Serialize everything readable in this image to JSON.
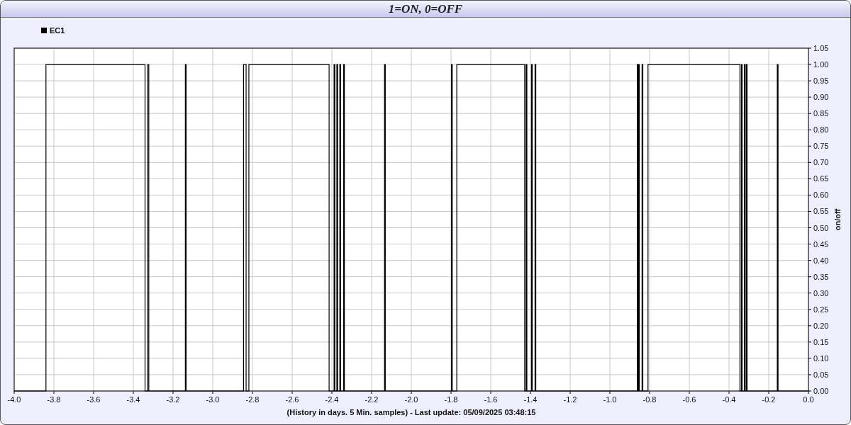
{
  "window": {
    "title": "1=ON, 0=OFF"
  },
  "chart": {
    "chart_data": {
      "type": "line",
      "grid": true,
      "xlabel": "(History in days. 5 Min. samples) - Last update: 05/09/2025 03:48:15",
      "ylabel": "on/off",
      "x": [
        -4,
        -3.84,
        -3.84,
        -3.341,
        -3.341,
        -3.327,
        -3.327,
        -3.322,
        -3.322,
        -3.138,
        -3.138,
        -3.134,
        -3.134,
        -2.845,
        -2.845,
        -2.832,
        -2.832,
        -2.818,
        -2.818,
        -2.414,
        -2.414,
        -2.389,
        -2.389,
        -2.385,
        -2.385,
        -2.375,
        -2.375,
        -2.371,
        -2.371,
        -2.36,
        -2.36,
        -2.356,
        -2.356,
        -2.341,
        -2.341,
        -2.337,
        -2.337,
        -2.135,
        -2.135,
        -2.131,
        -2.131,
        -1.798,
        -1.798,
        -1.794,
        -1.794,
        -1.771,
        -1.771,
        -1.429,
        -1.429,
        -1.422,
        -1.422,
        -1.418,
        -1.418,
        -1.395,
        -1.395,
        -1.391,
        -1.391,
        -1.377,
        -1.377,
        -1.373,
        -1.373,
        -0.862,
        -0.862,
        -0.858,
        -0.858,
        -0.856,
        -0.856,
        -0.852,
        -0.852,
        -0.838,
        -0.838,
        -0.834,
        -0.834,
        -0.808,
        -0.808,
        -0.345,
        -0.345,
        -0.338,
        -0.338,
        -0.334,
        -0.334,
        -0.323,
        -0.323,
        -0.319,
        -0.319,
        -0.313,
        -0.313,
        -0.309,
        -0.309,
        -0.157,
        -0.157,
        -0.153,
        -0.153,
        0
      ],
      "series": [
        {
          "name": "EC1",
          "color": "#000000",
          "values": [
            0,
            0,
            1,
            1,
            0,
            0,
            1,
            1,
            0,
            0,
            1,
            1,
            0,
            0,
            1,
            1,
            0,
            0,
            1,
            1,
            0,
            0,
            1,
            1,
            0,
            0,
            1,
            1,
            0,
            0,
            1,
            1,
            0,
            0,
            1,
            1,
            0,
            0,
            1,
            1,
            0,
            0,
            1,
            1,
            0,
            0,
            1,
            1,
            0,
            0,
            1,
            1,
            0,
            0,
            1,
            1,
            0,
            0,
            1,
            1,
            0,
            0,
            1,
            1,
            0,
            0,
            1,
            1,
            0,
            0,
            1,
            1,
            0,
            0,
            1,
            1,
            0,
            0,
            1,
            1,
            0,
            0,
            1,
            1,
            0,
            0,
            1,
            1,
            0,
            0,
            1,
            1,
            0,
            0
          ]
        }
      ],
      "xlim": [
        -4,
        0
      ],
      "ylim": [
        0,
        1.05
      ],
      "xticks": [
        {
          "value": -4,
          "label": "-4.0"
        },
        {
          "value": -3.8,
          "label": "-3.8"
        },
        {
          "value": -3.6,
          "label": "-3.6"
        },
        {
          "value": -3.4,
          "label": "-3.4"
        },
        {
          "value": -3.2,
          "label": "-3.2"
        },
        {
          "value": -3,
          "label": "-3.0"
        },
        {
          "value": -2.8,
          "label": "-2.8"
        },
        {
          "value": -2.6,
          "label": "-2.6"
        },
        {
          "value": -2.4,
          "label": "-2.4"
        },
        {
          "value": -2.2,
          "label": "-2.2"
        },
        {
          "value": -2,
          "label": "-2.0"
        },
        {
          "value": -1.8,
          "label": "-1.8"
        },
        {
          "value": -1.6,
          "label": "-1.6"
        },
        {
          "value": -1.4,
          "label": "-1.4"
        },
        {
          "value": -1.2,
          "label": "-1.2"
        },
        {
          "value": -1,
          "label": "-1.0"
        },
        {
          "value": -0.8,
          "label": "-0.8"
        },
        {
          "value": -0.6,
          "label": "-0.6"
        },
        {
          "value": -0.4,
          "label": "-0.4"
        },
        {
          "value": -0.2,
          "label": "-0.2"
        },
        {
          "value": 0,
          "label": "0.0"
        }
      ],
      "yticks": [
        {
          "value": 0,
          "label": "0.00"
        },
        {
          "value": 0.05,
          "label": "0.05"
        },
        {
          "value": 0.1,
          "label": "0.10"
        },
        {
          "value": 0.15,
          "label": "0.15"
        },
        {
          "value": 0.2,
          "label": "0.20"
        },
        {
          "value": 0.25,
          "label": "0.25"
        },
        {
          "value": 0.3,
          "label": "0.30"
        },
        {
          "value": 0.35,
          "label": "0.35"
        },
        {
          "value": 0.4,
          "label": "0.40"
        },
        {
          "value": 0.45,
          "label": "0.45"
        },
        {
          "value": 0.5,
          "label": "0.50"
        },
        {
          "value": 0.55,
          "label": "0.55"
        },
        {
          "value": 0.6,
          "label": "0.60"
        },
        {
          "value": 0.65,
          "label": "0.65"
        },
        {
          "value": 0.7,
          "label": "0.70"
        },
        {
          "value": 0.75,
          "label": "0.75"
        },
        {
          "value": 0.8,
          "label": "0.80"
        },
        {
          "value": 0.85,
          "label": "0.85"
        },
        {
          "value": 0.9,
          "label": "0.90"
        },
        {
          "value": 0.95,
          "label": "0.95"
        },
        {
          "value": 1,
          "label": "1.00"
        },
        {
          "value": 1.05,
          "label": "1.05"
        }
      ]
    }
  }
}
